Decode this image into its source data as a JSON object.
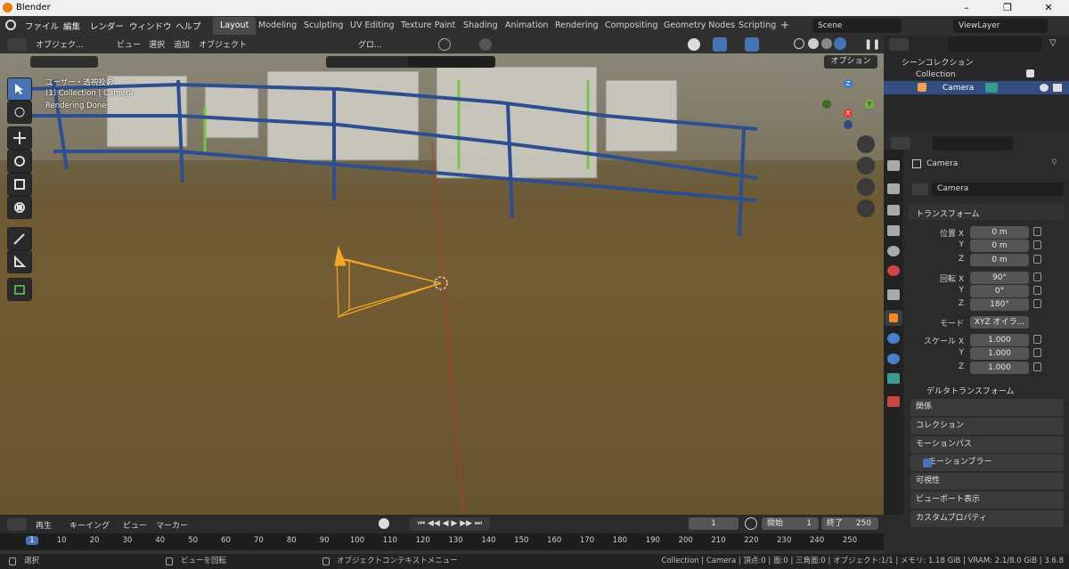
{
  "app": {
    "title": "Blender",
    "accent": "#4772b3"
  },
  "menu": [
    "ファイル",
    "編集",
    "レンダー",
    "ウィンドウ",
    "ヘルプ"
  ],
  "workspaces": [
    "Layout",
    "Modeling",
    "Sculpting",
    "UV Editing",
    "Texture Paint",
    "Shading",
    "Animation",
    "Rendering",
    "Compositing",
    "Geometry Nodes",
    "Scripting"
  ],
  "active_workspace": "Layout",
  "scene": "Scene",
  "viewlayer": "ViewLayer",
  "viewport_header": {
    "mode": "オブジェク...",
    "menus": [
      "ビュー",
      "選択",
      "追加",
      "オブジェクト"
    ],
    "transform": "グロ...",
    "options": "オプション"
  },
  "viewport": {
    "line1": "ユーザー・透視投影",
    "line2": "(1) Collection | Camera",
    "line3": "Rendering Done",
    "gizmo": {
      "z": "Z",
      "y": "Y",
      "x": "X"
    }
  },
  "outliner": {
    "root": "シーンコレクション",
    "collection": "Collection",
    "camera": "Camera"
  },
  "properties": {
    "object_name": "Camera",
    "data_name": "Camera",
    "transform_title": "トランスフォーム",
    "loc_label": "位置 X",
    "y": "Y",
    "z": "Z",
    "loc": [
      "0 m",
      "0 m",
      "0 m"
    ],
    "rot_label": "回転 X",
    "rot": [
      "90°",
      "0°",
      "180°"
    ],
    "mode_label": "モード",
    "mode_value": "XYZ オイラ...",
    "scale_label": "スケール X",
    "scale": [
      "1.000",
      "1.000",
      "1.000"
    ],
    "delta": "デルタトランスフォーム",
    "panels": [
      "関係",
      "コレクション",
      "モーションパス",
      "モーションブラー",
      "可視性",
      "ビューポート表示",
      "カスタムプロパティ"
    ]
  },
  "timeline": {
    "menus": [
      "再生",
      "キーイング",
      "ビュー",
      "マーカー"
    ],
    "current": "1",
    "start_label": "開始",
    "start": "1",
    "end_label": "終了",
    "end": "250",
    "ticks": [
      "1",
      "10",
      "20",
      "30",
      "40",
      "50",
      "60",
      "70",
      "80",
      "90",
      "100",
      "110",
      "120",
      "130",
      "140",
      "150",
      "160",
      "170",
      "180",
      "190",
      "200",
      "210",
      "220",
      "230",
      "240",
      "250"
    ]
  },
  "status": {
    "select": "選択",
    "rotate": "ビューを回転",
    "context": "オブジェクトコンテキストメニュー",
    "info": "Collection | Camera | 頂点:0 | 面:0 | 三角面:0 | オブジェクト:1/1 | メモリ: 1.18 GiB | VRAM: 2.1/8.0 GiB | 3.6.8"
  }
}
